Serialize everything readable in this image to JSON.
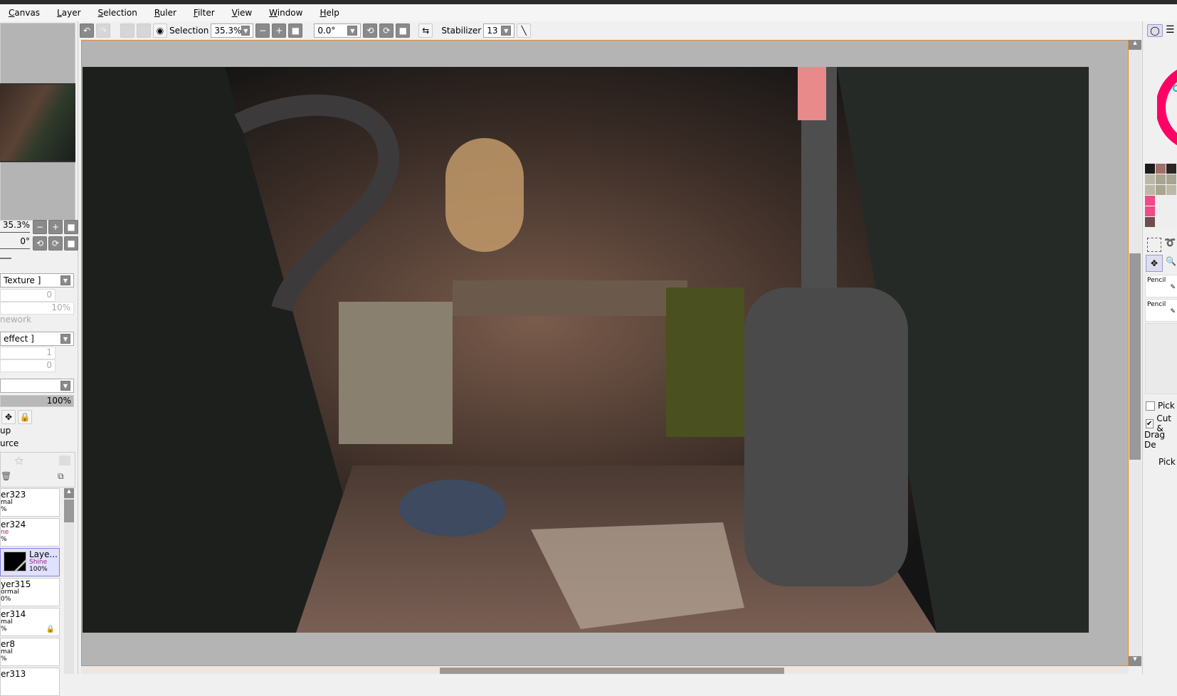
{
  "menu": [
    "Canvas",
    "Layer",
    "Selection",
    "Ruler",
    "Filter",
    "View",
    "Window",
    "Help"
  ],
  "toolbar": {
    "selection_label": "Selection",
    "zoom": "35.3%",
    "angle": "0.0°",
    "stabilizer_label": "Stabilizer",
    "stabilizer": "13"
  },
  "left": {
    "zoom": "35.3%",
    "angle": "0°",
    "texture": "Texture ]",
    "texture_val1": "0",
    "texture_val2": "10%",
    "framework": "nework",
    "effect": "effect ]",
    "effect_val1": "1",
    "effect_val2": "0",
    "opacity": "100%",
    "group": "up",
    "source": "urce",
    "layers": [
      {
        "name": "er323",
        "mode": "mal",
        "opacity": "%"
      },
      {
        "name": "er324",
        "mode": "ne",
        "opacity": "%"
      },
      {
        "name": "Laye...",
        "mode": "Shine",
        "opacity": "100%",
        "selected": true
      },
      {
        "name": "yer315",
        "mode": "ormal",
        "opacity": "0%"
      },
      {
        "name": "er314",
        "mode": "mal",
        "opacity": "%",
        "locked": true
      },
      {
        "name": "er8",
        "mode": "mal",
        "opacity": "%"
      },
      {
        "name": "er313",
        "mode": "",
        "opacity": ""
      }
    ]
  },
  "right": {
    "brushes": [
      "Pencil",
      "Pencil"
    ],
    "pick_label": "Pick",
    "cut_label": "Cut &",
    "drag_label": "Drag De",
    "pick2_label": "Pick",
    "swatches": [
      "#1c1c1c",
      "#a07068",
      "#2e2624",
      "#bcb8a6",
      "#a8a690",
      "#a6a690",
      "#bcb8a6",
      "#a8a690",
      "#bcb8a6",
      "#f04a88",
      "#eeeeee",
      "#eeeeee",
      "#f04a88",
      "#eeeeee",
      "#eeeeee",
      "#704e4c",
      "#eeeeee",
      "#eeeeee"
    ]
  },
  "colors": {
    "accent": "#e58a3c",
    "canvas_bg": "#b4b4b4",
    "shine": "#a0207a"
  }
}
